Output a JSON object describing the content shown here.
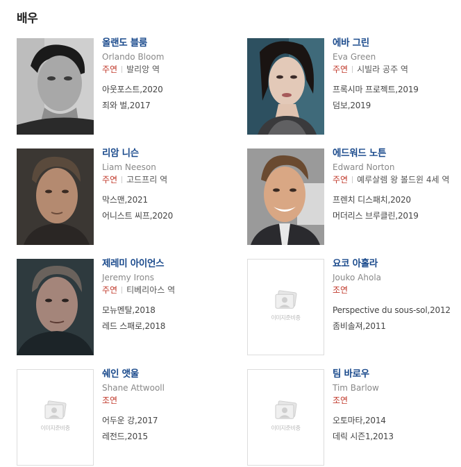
{
  "section": {
    "title": "배우"
  },
  "placeholder_text": "이미지준비중",
  "actors": [
    {
      "name": "올랜도 블룸",
      "name_en": "Orlando Bloom",
      "role_type": "주연",
      "role": "발리앙 역",
      "films": [
        {
          "title": "아웃포스트",
          "year": "2020"
        },
        {
          "title": "죄와 벌",
          "year": "2017"
        }
      ]
    },
    {
      "name": "에바 그린",
      "name_en": "Eva Green",
      "role_type": "주연",
      "role": "시빌라 공주 역",
      "films": [
        {
          "title": "프록시마 프로젝트",
          "year": "2019"
        },
        {
          "title": "덤보",
          "year": "2019"
        }
      ]
    },
    {
      "name": "리암 니슨",
      "name_en": "Liam Neeson",
      "role_type": "주연",
      "role": "고드프리 역",
      "films": [
        {
          "title": "막스맨",
          "year": "2021"
        },
        {
          "title": "어니스트 씨프",
          "year": "2020"
        }
      ]
    },
    {
      "name": "에드워드 노튼",
      "name_en": "Edward Norton",
      "role_type": "주연",
      "role": "예루살렘 왕 볼드윈 4세 역",
      "films": [
        {
          "title": "프렌치 디스패치",
          "year": "2020"
        },
        {
          "title": "머더리스 브루클린",
          "year": "2019"
        }
      ]
    },
    {
      "name": "제레미 아이언스",
      "name_en": "Jeremy Irons",
      "role_type": "주연",
      "role": "티베리아스 역",
      "films": [
        {
          "title": "모뉴멘탈",
          "year": "2018"
        },
        {
          "title": "레드 스패로",
          "year": "2018"
        }
      ]
    },
    {
      "name": "요코 아홀라",
      "name_en": "Jouko Ahola",
      "role_type": "조연",
      "role": "",
      "films": [
        {
          "title": "Perspective du sous-sol",
          "year": "2012"
        },
        {
          "title": "좀비솔져",
          "year": "2011"
        }
      ]
    },
    {
      "name": "쉐인 앳울",
      "name_en": "Shane Attwooll",
      "role_type": "조연",
      "role": "",
      "films": [
        {
          "title": "어두운 강",
          "year": "2017"
        },
        {
          "title": "레전드",
          "year": "2015"
        }
      ]
    },
    {
      "name": "팀 바로우",
      "name_en": "Tim Barlow",
      "role_type": "조연",
      "role": "",
      "films": [
        {
          "title": "오토마타",
          "year": "2014"
        },
        {
          "title": "데릭 시즌1",
          "year": "2013"
        }
      ]
    }
  ]
}
